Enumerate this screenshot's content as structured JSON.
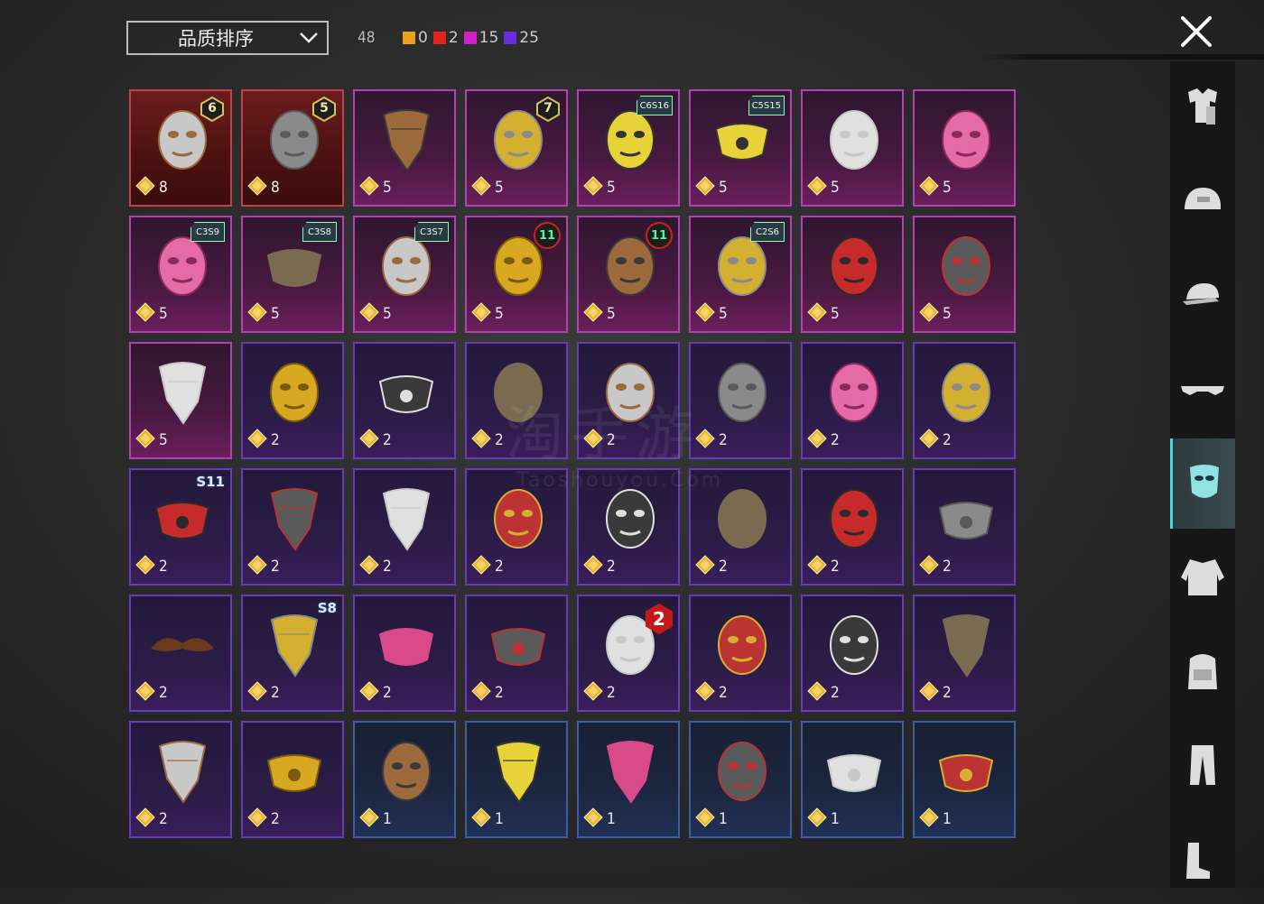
{
  "sort": {
    "label": "品质排序"
  },
  "summary": {
    "total": "48",
    "tiers": [
      {
        "color": "#e8a21c",
        "count": "0"
      },
      {
        "color": "#e4231f",
        "count": "2"
      },
      {
        "color": "#d21fc8",
        "count": "15"
      },
      {
        "color": "#6a2be0",
        "count": "25"
      }
    ]
  },
  "watermark": {
    "cn": "淘手游",
    "en": "Taoshouyou.Com"
  },
  "items": [
    {
      "qty": "8",
      "rarity": "red",
      "badge": {
        "type": "hex",
        "text": "6"
      },
      "icon": "plague-mask-icon"
    },
    {
      "qty": "8",
      "rarity": "red",
      "badge": {
        "type": "hex",
        "text": "5"
      },
      "icon": "tech-mask-icon"
    },
    {
      "qty": "5",
      "rarity": "pink",
      "badge": null,
      "icon": "brown-bandana-icon"
    },
    {
      "qty": "5",
      "rarity": "pink",
      "badge": {
        "type": "hex",
        "text": "7"
      },
      "icon": "wire-mask-icon"
    },
    {
      "qty": "5",
      "rarity": "pink",
      "badge": {
        "type": "season",
        "text": "C6S16"
      },
      "icon": "gas-mask-yellow-icon"
    },
    {
      "qty": "5",
      "rarity": "pink",
      "badge": {
        "type": "season",
        "text": "C5S15"
      },
      "icon": "respirator-yellow-icon"
    },
    {
      "qty": "5",
      "rarity": "pink",
      "badge": null,
      "icon": "fox-mask-icon"
    },
    {
      "qty": "5",
      "rarity": "pink",
      "badge": null,
      "icon": "visor-pink-icon"
    },
    {
      "qty": "5",
      "rarity": "pink",
      "badge": {
        "type": "season",
        "text": "C3S9"
      },
      "icon": "gas-mask-pink-icon"
    },
    {
      "qty": "5",
      "rarity": "pink",
      "badge": {
        "type": "season",
        "text": "C3S8"
      },
      "icon": "respirator-grey-icon"
    },
    {
      "qty": "5",
      "rarity": "pink",
      "badge": {
        "type": "season",
        "text": "C3S7"
      },
      "icon": "masquerade-mask-icon"
    },
    {
      "qty": "5",
      "rarity": "pink",
      "badge": {
        "type": "round",
        "text": "11"
      },
      "icon": "white-gold-mask-icon"
    },
    {
      "qty": "5",
      "rarity": "pink",
      "badge": {
        "type": "round",
        "text": "11"
      },
      "icon": "oni-mask-icon"
    },
    {
      "qty": "5",
      "rarity": "pink",
      "badge": {
        "type": "season",
        "text": "C2S6"
      },
      "icon": "tribal-mask-icon"
    },
    {
      "qty": "5",
      "rarity": "pink",
      "badge": null,
      "icon": "skull-mask-red-icon"
    },
    {
      "qty": "5",
      "rarity": "pink",
      "badge": null,
      "icon": "bird-mask-icon"
    },
    {
      "qty": "5",
      "rarity": "pink",
      "badge": null,
      "icon": "skull-bandana-icon"
    },
    {
      "qty": "2",
      "rarity": "purple",
      "badge": null,
      "icon": "gold-mask-icon"
    },
    {
      "qty": "2",
      "rarity": "purple",
      "badge": null,
      "icon": "black-face-mask-icon"
    },
    {
      "qty": "2",
      "rarity": "purple",
      "badge": null,
      "icon": "knight-mask-icon"
    },
    {
      "qty": "2",
      "rarity": "purple",
      "badge": null,
      "icon": "cyber-eye-mask-icon"
    },
    {
      "qty": "2",
      "rarity": "purple",
      "badge": null,
      "icon": "mammoth-mask-icon"
    },
    {
      "qty": "2",
      "rarity": "purple",
      "badge": null,
      "icon": "pink-dino-mask-icon"
    },
    {
      "qty": "2",
      "rarity": "purple",
      "badge": null,
      "icon": "silver-mask-icon"
    },
    {
      "qty": "2",
      "rarity": "purple",
      "badge": {
        "type": "s",
        "text": "S11"
      },
      "icon": "red-half-mask-icon"
    },
    {
      "qty": "2",
      "rarity": "purple",
      "badge": null,
      "icon": "dark-bandana-icon"
    },
    {
      "qty": "2",
      "rarity": "purple",
      "badge": null,
      "icon": "plaid-bandana-icon"
    },
    {
      "qty": "2",
      "rarity": "purple",
      "badge": null,
      "icon": "bandage-mask-icon"
    },
    {
      "qty": "2",
      "rarity": "purple",
      "badge": null,
      "icon": "old-gas-mask-icon"
    },
    {
      "qty": "2",
      "rarity": "purple",
      "badge": null,
      "icon": "leather-mask-icon"
    },
    {
      "qty": "2",
      "rarity": "purple",
      "badge": null,
      "icon": "red-black-mask-icon"
    },
    {
      "qty": "2",
      "rarity": "purple",
      "badge": null,
      "icon": "grey-face-mask-icon"
    },
    {
      "qty": "2",
      "rarity": "purple",
      "badge": null,
      "icon": "mustache-icon"
    },
    {
      "qty": "2",
      "rarity": "purple",
      "badge": {
        "type": "s",
        "text": "S8"
      },
      "icon": "flame-bandana-icon"
    },
    {
      "qty": "2",
      "rarity": "purple",
      "badge": null,
      "icon": "grin-face-mask-icon"
    },
    {
      "qty": "2",
      "rarity": "purple",
      "badge": null,
      "icon": "x-face-mask-icon"
    },
    {
      "qty": "2",
      "rarity": "purple",
      "badge": {
        "type": "red",
        "text": "2"
      },
      "icon": "clown-mask-icon"
    },
    {
      "qty": "2",
      "rarity": "purple",
      "badge": null,
      "icon": "dark-skull-mask-icon"
    },
    {
      "qty": "2",
      "rarity": "purple",
      "badge": null,
      "icon": "armor-mask-icon"
    },
    {
      "qty": "2",
      "rarity": "purple",
      "badge": null,
      "icon": "black-bandana-icon"
    },
    {
      "qty": "2",
      "rarity": "purple",
      "badge": null,
      "icon": "flag-bandana-icon"
    },
    {
      "qty": "2",
      "rarity": "purple",
      "badge": null,
      "icon": "gold-face-mask-icon"
    },
    {
      "qty": "1",
      "rarity": "blue",
      "badge": null,
      "icon": "hockey-skull-mask-icon"
    },
    {
      "qty": "1",
      "rarity": "blue",
      "badge": null,
      "icon": "yellow-bandana-icon"
    },
    {
      "qty": "1",
      "rarity": "blue",
      "badge": null,
      "icon": "web-bandana-icon"
    },
    {
      "qty": "1",
      "rarity": "blue",
      "badge": null,
      "icon": "purple-theater-mask-icon"
    },
    {
      "qty": "1",
      "rarity": "blue",
      "badge": null,
      "icon": "bronze-face-mask-icon"
    },
    {
      "qty": "1",
      "rarity": "blue",
      "badge": null,
      "icon": "dark-respirator-icon"
    }
  ],
  "sidebar": [
    {
      "name": "outfit-icon",
      "active": false
    },
    {
      "name": "helmet-icon",
      "active": false
    },
    {
      "name": "cap-icon",
      "active": false
    },
    {
      "name": "glasses-icon",
      "active": false
    },
    {
      "name": "mask-icon",
      "active": true
    },
    {
      "name": "jacket-icon",
      "active": false
    },
    {
      "name": "backpack-icon",
      "active": false
    },
    {
      "name": "pants-icon",
      "active": false
    },
    {
      "name": "shoes-icon",
      "active": false
    }
  ]
}
